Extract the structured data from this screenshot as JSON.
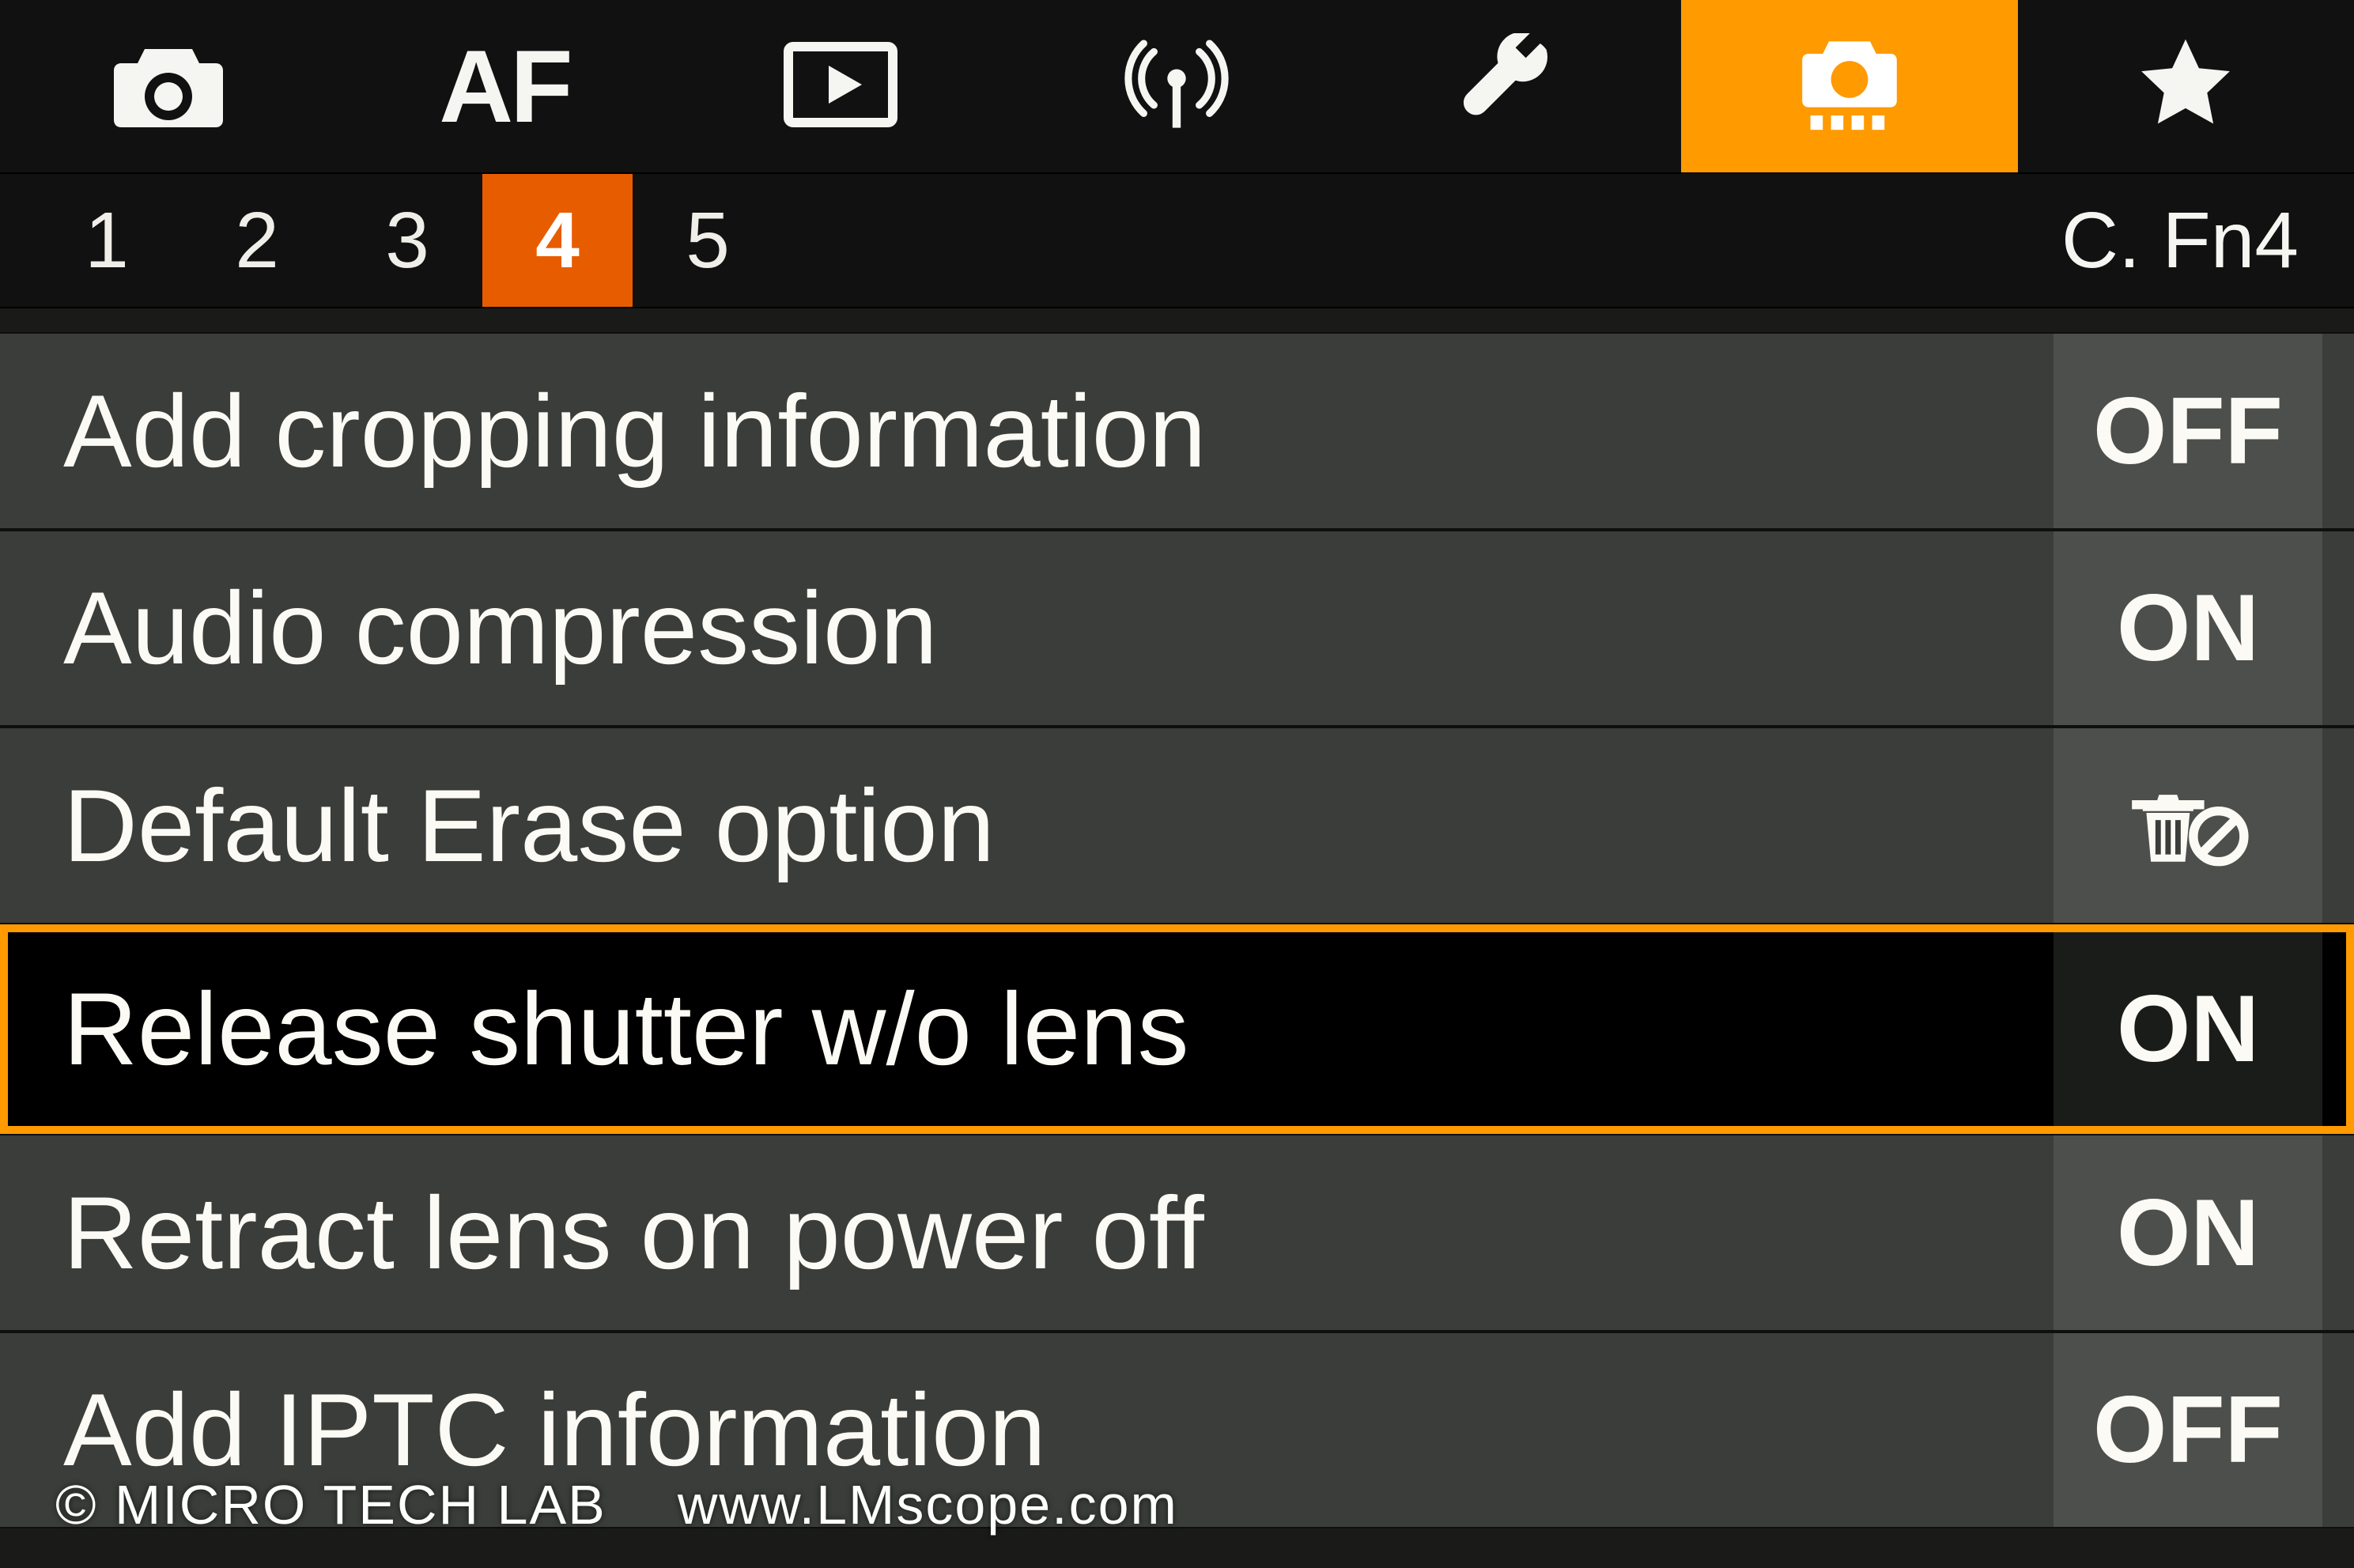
{
  "topTabs": {
    "shooting": {
      "name": "shooting",
      "icon": "camera",
      "active": false
    },
    "af": {
      "name": "af",
      "label": "AF",
      "active": false
    },
    "playback": {
      "name": "playback",
      "icon": "play",
      "active": false
    },
    "wireless": {
      "name": "wireless",
      "icon": "antenna",
      "active": false
    },
    "setup": {
      "name": "setup",
      "icon": "wrench",
      "active": false
    },
    "custom": {
      "name": "custom",
      "icon": "camera-custom",
      "active": true
    },
    "mymenu": {
      "name": "mymenu",
      "icon": "star",
      "active": false
    }
  },
  "subPages": {
    "items": [
      {
        "label": "1",
        "active": false
      },
      {
        "label": "2",
        "active": false
      },
      {
        "label": "3",
        "active": false
      },
      {
        "label": "4",
        "active": true
      },
      {
        "label": "5",
        "active": false
      }
    ],
    "rightLabel": "C. Fn4"
  },
  "menu": {
    "items": [
      {
        "label": "Add cropping information",
        "value": "OFF",
        "valueType": "text",
        "selected": false
      },
      {
        "label": "Audio compression",
        "value": "ON",
        "valueType": "text",
        "selected": false
      },
      {
        "label": "Default Erase option",
        "value": "erase-cancel",
        "valueType": "icon",
        "selected": false
      },
      {
        "label": "Release shutter w/o lens",
        "value": "ON",
        "valueType": "text",
        "selected": true
      },
      {
        "label": "Retract lens on power off",
        "value": "ON",
        "valueType": "text",
        "selected": false
      },
      {
        "label": "Add IPTC information",
        "value": "OFF",
        "valueType": "text",
        "selected": false
      }
    ]
  },
  "watermark": {
    "left": "©  MICRO TECH LAB",
    "right": "www.LMscope.com"
  },
  "colors": {
    "accentOrange": "#ff9a00",
    "accentDeepOrange": "#e85c00",
    "rowBg": "#3a3d3a",
    "valueBg": "#4c4f4c"
  }
}
